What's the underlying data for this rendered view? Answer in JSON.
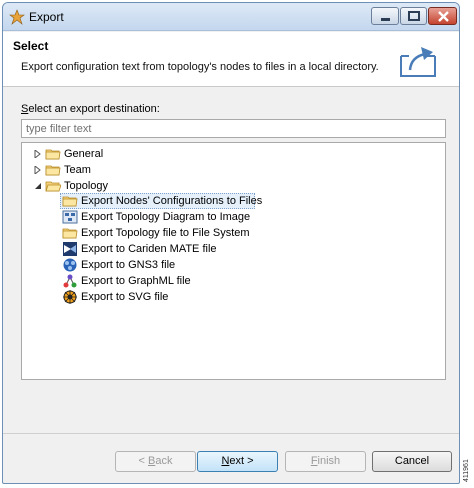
{
  "window": {
    "title": "Export"
  },
  "header": {
    "title": "Select",
    "description": "Export configuration text from topology's nodes to files in a local directory."
  },
  "destination_label_pre": "",
  "destination_label_access": "S",
  "destination_label_rest": "elect an export destination:",
  "filter": {
    "placeholder": "type filter text",
    "value": ""
  },
  "tree": [
    {
      "label": "General",
      "expanded": false,
      "icon": "folder-icon"
    },
    {
      "label": "Team",
      "expanded": false,
      "icon": "folder-icon"
    },
    {
      "label": "Topology",
      "expanded": true,
      "icon": "folder-open-icon",
      "children": [
        {
          "label": "Export Nodes' Configurations to Files",
          "icon": "folder-icon",
          "selected": true
        },
        {
          "label": "Export Topology Diagram to Image",
          "icon": "image-icon"
        },
        {
          "label": "Export Topology file to File System",
          "icon": "folder-icon"
        },
        {
          "label": "Export to Cariden MATE file",
          "icon": "cariden-icon"
        },
        {
          "label": "Export to GNS3 file",
          "icon": "gns3-icon"
        },
        {
          "label": "Export to GraphML file",
          "icon": "graphml-icon"
        },
        {
          "label": "Export to SVG file",
          "icon": "svg-icon"
        }
      ]
    }
  ],
  "buttons": {
    "back_pre": "< ",
    "back_key": "B",
    "back_rest": "ack",
    "next_key": "N",
    "next_rest": "ext >",
    "finish_key": "F",
    "finish_rest": "inish",
    "cancel": "Cancel"
  },
  "figure_code": "411961"
}
